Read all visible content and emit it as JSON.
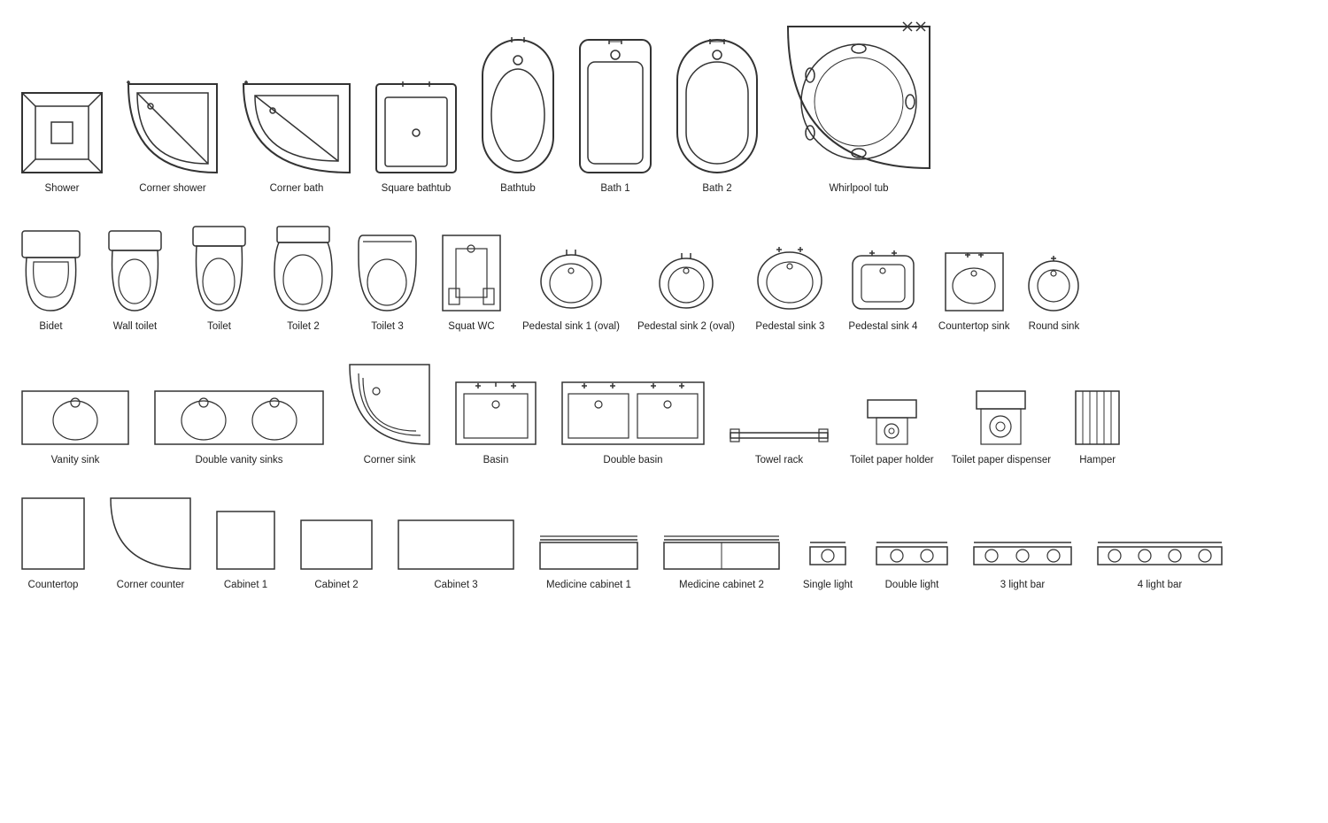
{
  "sections": [
    {
      "id": "bathing",
      "items": [
        {
          "id": "shower",
          "label": "Shower"
        },
        {
          "id": "corner-shower",
          "label": "Corner shower"
        },
        {
          "id": "corner-bath",
          "label": "Corner bath"
        },
        {
          "id": "square-bathtub",
          "label": "Square bathtub"
        },
        {
          "id": "bathtub",
          "label": "Bathtub"
        },
        {
          "id": "bath1",
          "label": "Bath 1"
        },
        {
          "id": "bath2",
          "label": "Bath 2"
        },
        {
          "id": "whirlpool",
          "label": "Whirlpool tub"
        }
      ]
    },
    {
      "id": "toilets-sinks",
      "items": [
        {
          "id": "bidet",
          "label": "Bidet"
        },
        {
          "id": "wall-toilet",
          "label": "Wall toilet"
        },
        {
          "id": "toilet",
          "label": "Toilet"
        },
        {
          "id": "toilet2",
          "label": "Toilet 2"
        },
        {
          "id": "toilet3",
          "label": "Toilet 3"
        },
        {
          "id": "squat-wc",
          "label": "Squat WC"
        },
        {
          "id": "pedestal-sink1",
          "label": "Pedestal sink 1 (oval)"
        },
        {
          "id": "pedestal-sink2",
          "label": "Pedestal sink 2 (oval)"
        },
        {
          "id": "pedestal-sink3",
          "label": "Pedestal sink 3"
        },
        {
          "id": "pedestal-sink4",
          "label": "Pedestal sink 4"
        },
        {
          "id": "countertop-sink",
          "label": "Countertop sink"
        },
        {
          "id": "round-sink",
          "label": "Round sink"
        }
      ]
    },
    {
      "id": "sinks-accessories",
      "items": [
        {
          "id": "vanity-sink",
          "label": "Vanity sink"
        },
        {
          "id": "double-vanity",
          "label": "Double vanity sinks"
        },
        {
          "id": "corner-sink",
          "label": "Corner sink"
        },
        {
          "id": "basin",
          "label": "Basin"
        },
        {
          "id": "double-basin",
          "label": "Double basin"
        },
        {
          "id": "towel-rack",
          "label": "Towel rack"
        },
        {
          "id": "toilet-paper-holder",
          "label": "Toilet paper holder"
        },
        {
          "id": "toilet-paper-dispenser",
          "label": "Toilet paper dispenser"
        },
        {
          "id": "hamper",
          "label": "Hamper"
        }
      ]
    },
    {
      "id": "cabinets-lights",
      "items": [
        {
          "id": "countertop",
          "label": "Countertop"
        },
        {
          "id": "corner-counter",
          "label": "Corner counter"
        },
        {
          "id": "cabinet1",
          "label": "Cabinet 1"
        },
        {
          "id": "cabinet2",
          "label": "Cabinet 2"
        },
        {
          "id": "cabinet3",
          "label": "Cabinet 3"
        },
        {
          "id": "medicine-cabinet1",
          "label": "Medicine cabinet 1"
        },
        {
          "id": "medicine-cabinet2",
          "label": "Medicine cabinet 2"
        },
        {
          "id": "single-light",
          "label": "Single light"
        },
        {
          "id": "double-light",
          "label": "Double light"
        },
        {
          "id": "three-light",
          "label": "3 light bar"
        },
        {
          "id": "four-light",
          "label": "4 light bar"
        }
      ]
    }
  ]
}
